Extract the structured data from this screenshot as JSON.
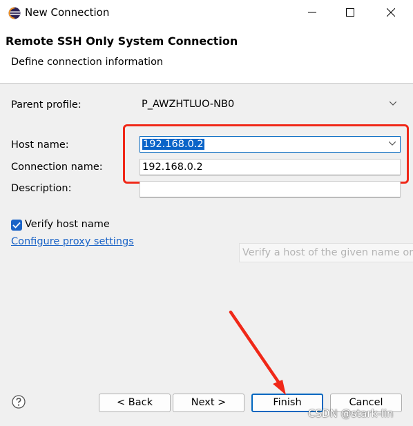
{
  "window": {
    "title": "New Connection"
  },
  "header": {
    "title": "Remote SSH Only System Connection",
    "description": "Define connection information"
  },
  "form": {
    "parent_profile_label": "Parent profile:",
    "parent_profile_value": "P_AWZHTLUO-NB0",
    "host_name_label": "Host name:",
    "host_name_value": "192.168.0.2",
    "connection_name_label": "Connection name:",
    "connection_name_value": "192.168.0.2",
    "description_label": "Description:",
    "description_value": "",
    "verify_host_label": "Verify host name",
    "verify_host_checked": true,
    "proxy_link": "Configure proxy settings",
    "tooltip": "Verify a host of the given name or"
  },
  "buttons": {
    "back": "< Back",
    "next": "Next >",
    "finish": "Finish",
    "cancel": "Cancel"
  },
  "watermark": "CSDN @stark-lin",
  "colors": {
    "highlight_box": "#f02818",
    "accent": "#1a63c7"
  }
}
